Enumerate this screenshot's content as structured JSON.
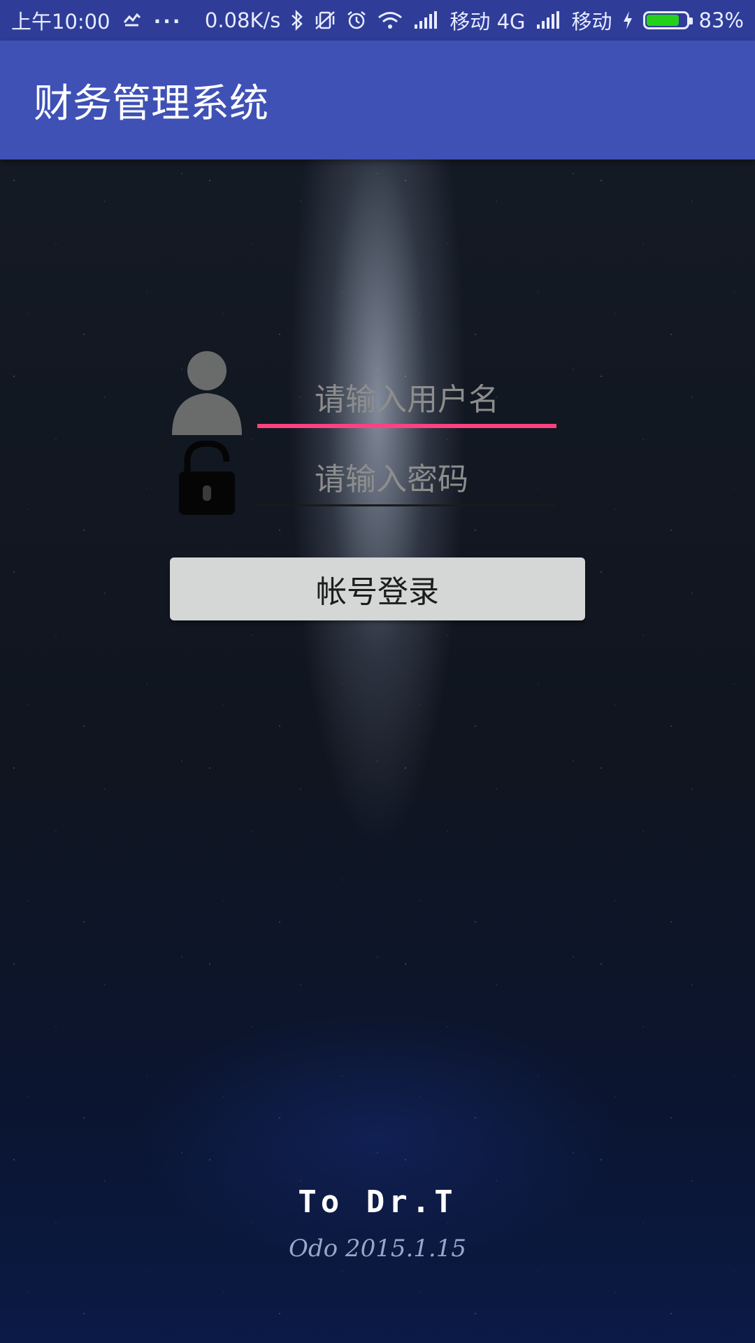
{
  "status_bar": {
    "time": "上午10:00",
    "overflow": "...",
    "net_speed": "0.08K/s",
    "carrier1": "移动 4G",
    "carrier2": "移动",
    "battery": "83%",
    "battery_level": 0.83,
    "battery_color": "#24d11a",
    "icons": [
      "notification-icon",
      "bluetooth-icon",
      "vibrate-off-icon",
      "alarm-icon",
      "wifi-icon",
      "signal-icon",
      "signal-icon",
      "charging-icon",
      "battery-icon"
    ]
  },
  "app_bar": {
    "title": "财务管理系统",
    "color": "#3f51b5"
  },
  "login": {
    "username_placeholder": "请输入用户名",
    "password_placeholder": "请输入密码",
    "submit_label": "帐号登录",
    "accent_color": "#ff4081"
  },
  "footer": {
    "dedication": "To Dr.T",
    "signature_date": "Odo 2015.1.15"
  }
}
